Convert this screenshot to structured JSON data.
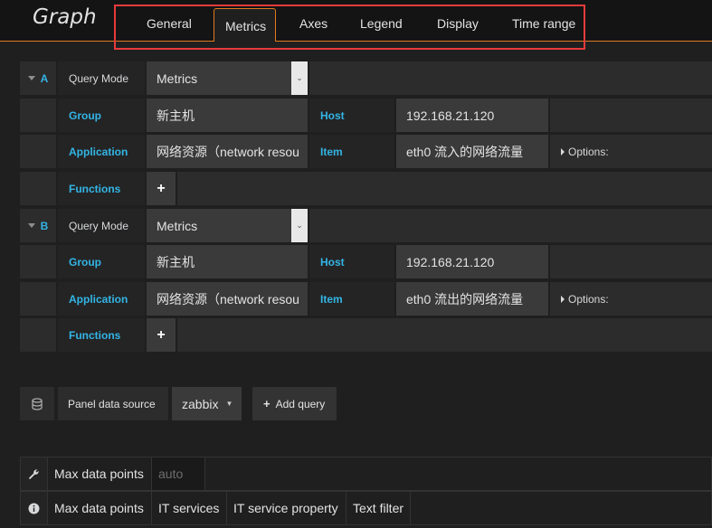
{
  "panel": {
    "title": "Graph"
  },
  "tabs": [
    "General",
    "Metrics",
    "Axes",
    "Legend",
    "Display",
    "Time range"
  ],
  "queries": [
    {
      "id": "A",
      "query_mode_label": "Query Mode",
      "query_mode": "Metrics",
      "group_label": "Group",
      "group": "新主机",
      "host_label": "Host",
      "host": "192.168.21.120",
      "application_label": "Application",
      "application": "网络资源（network resou",
      "item_label": "Item",
      "item": "eth0 流入的网络流量",
      "options_label": "Options:",
      "functions_label": "Functions",
      "add_function": "+"
    },
    {
      "id": "B",
      "query_mode_label": "Query Mode",
      "query_mode": "Metrics",
      "group_label": "Group",
      "group": "新主机",
      "host_label": "Host",
      "host": "192.168.21.120",
      "application_label": "Application",
      "application": "网络资源（network resou",
      "item_label": "Item",
      "item": "eth0 流出的网络流量",
      "options_label": "Options:",
      "functions_label": "Functions",
      "add_function": "+"
    }
  ],
  "datasource": {
    "label": "Panel data source",
    "value": "zabbix",
    "add_query": "Add query"
  },
  "options_bar_1": {
    "label": "Max data points",
    "value": "auto"
  },
  "options_bar_2": [
    "Max data points",
    "IT services",
    "IT service property",
    "Text filter"
  ],
  "icons": {
    "database": "database-icon",
    "wrench": "wrench-icon",
    "info": "info-icon"
  },
  "colors": {
    "accent": "#e07a1f",
    "link": "#33b5e5",
    "highlight_box": "#e63b3b"
  }
}
